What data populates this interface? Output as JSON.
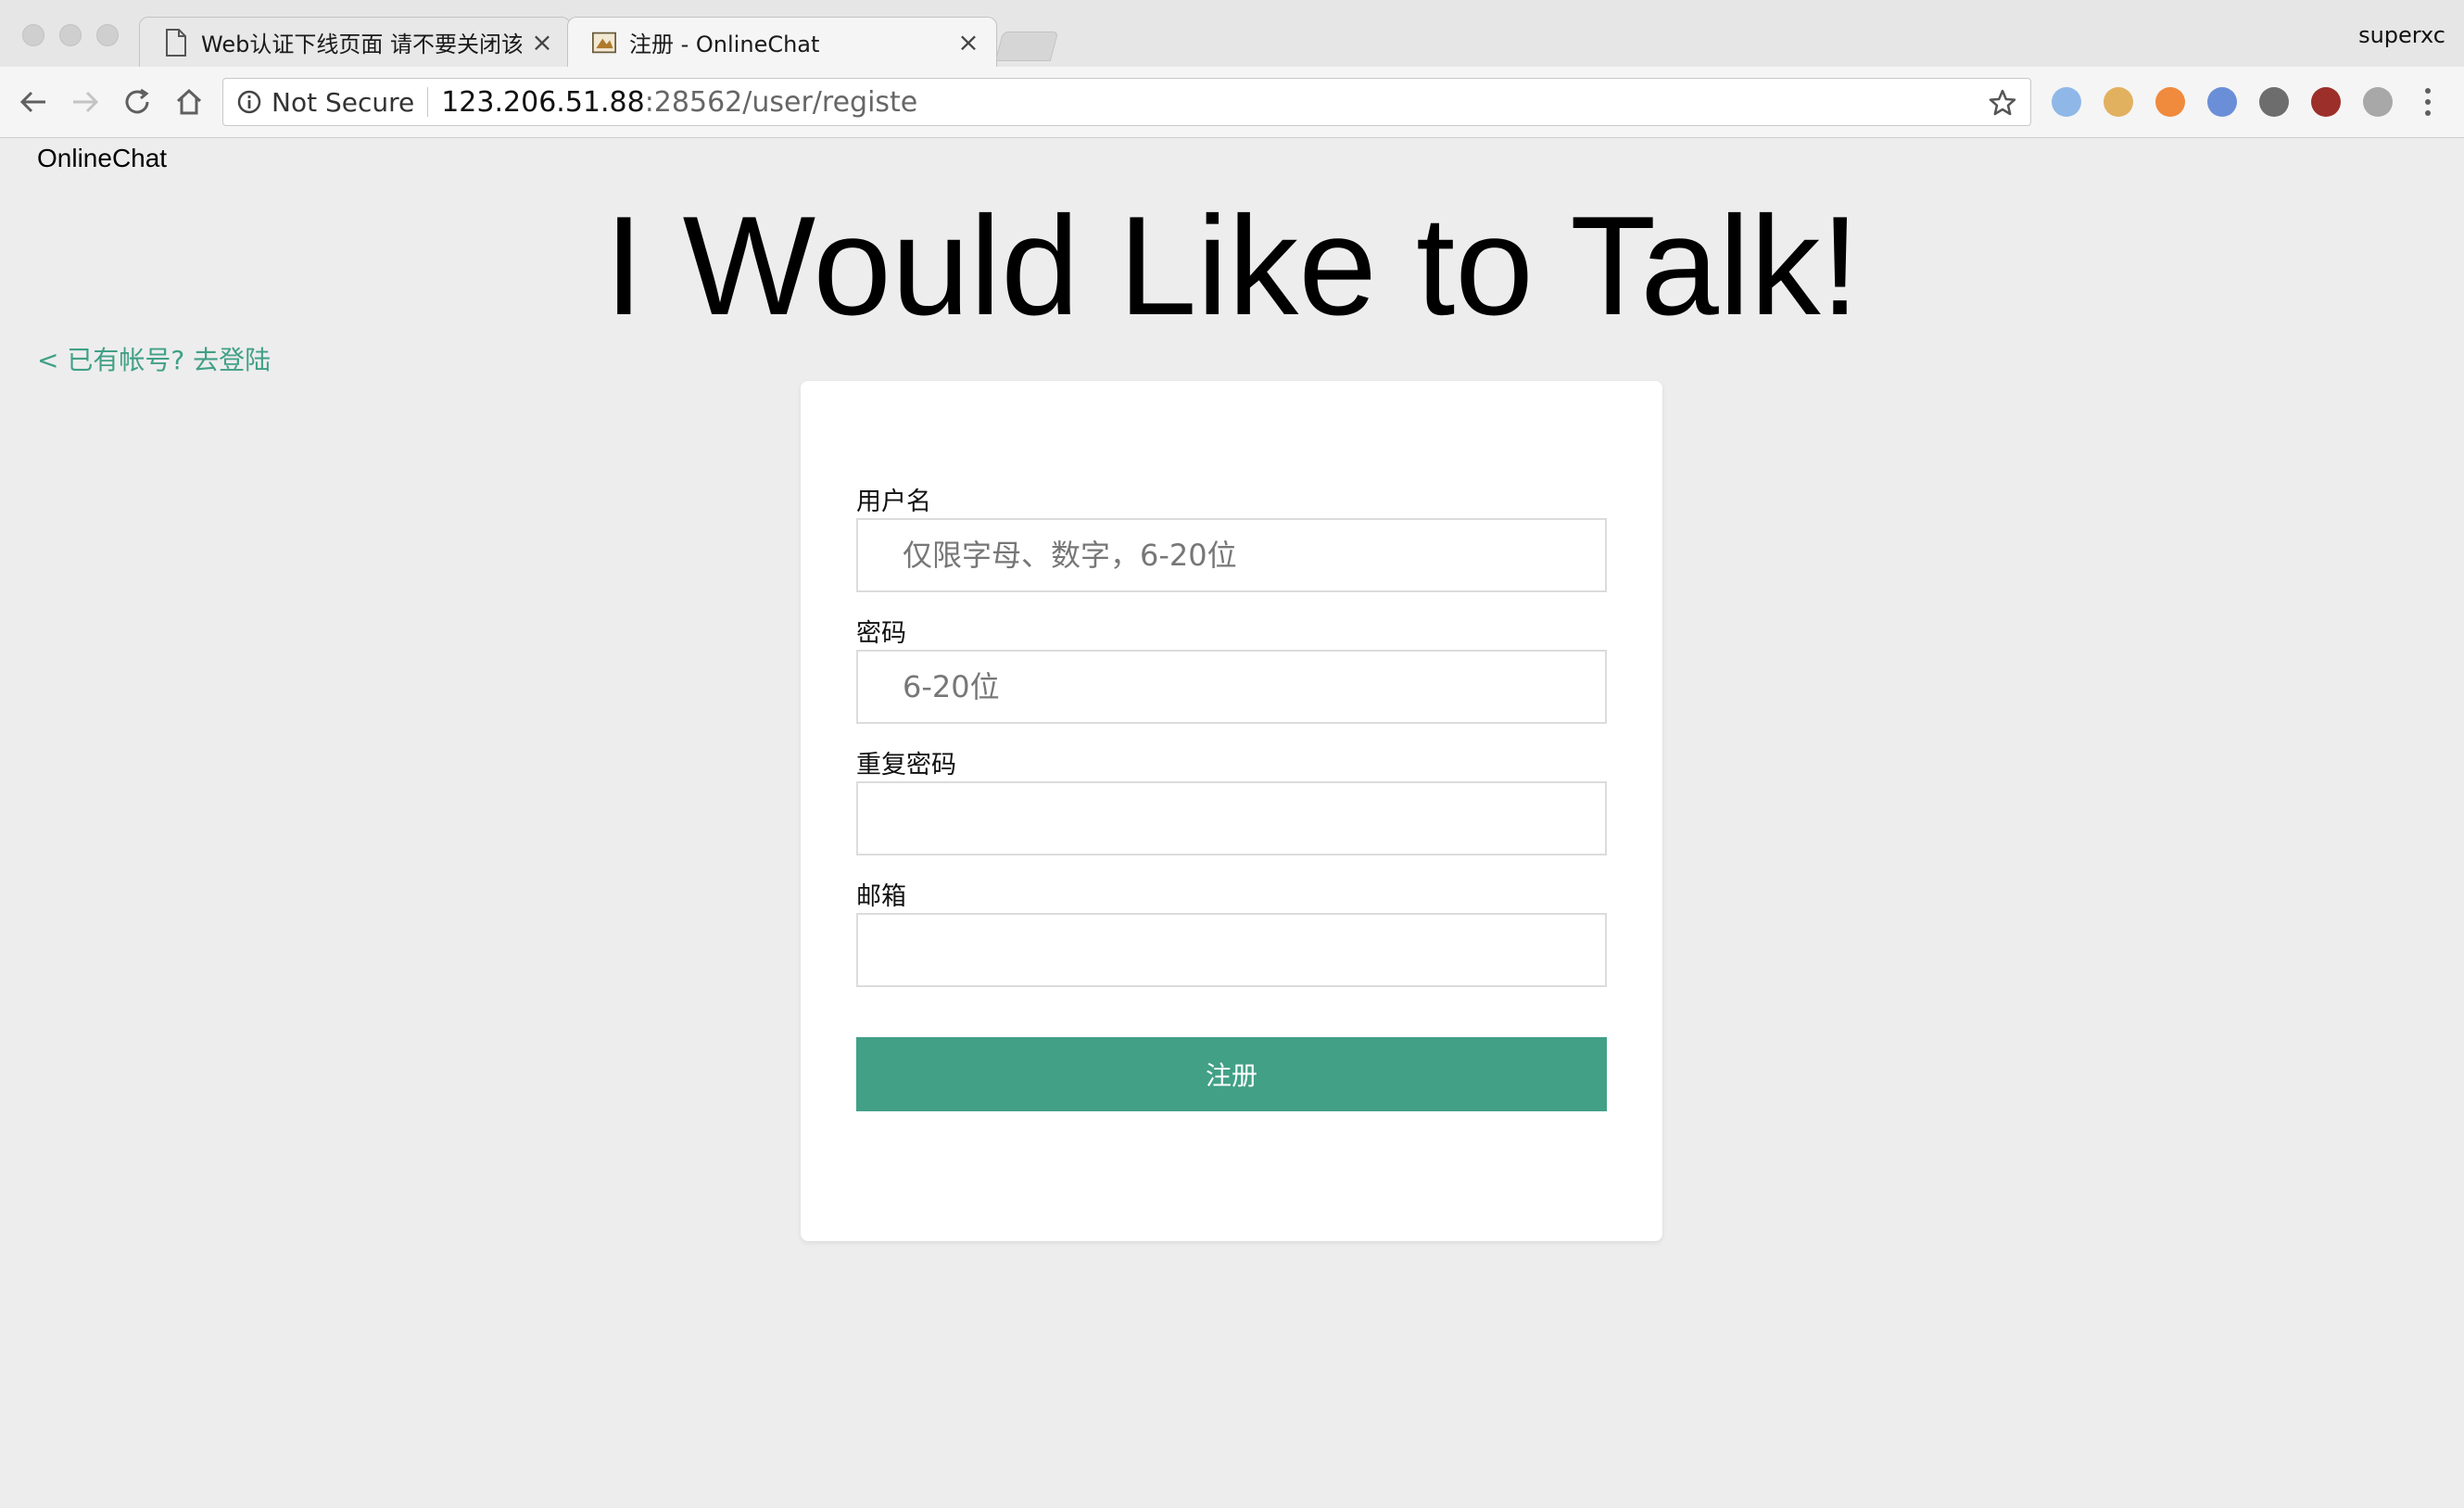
{
  "browser": {
    "tabs": [
      {
        "title": "Web认证下线页面 请不要关闭该",
        "close": "×",
        "icon": "document-icon"
      },
      {
        "title": "注册 - OnlineChat",
        "close": "×",
        "icon": "favicon-icon"
      }
    ],
    "profile": "superxc",
    "address_bar": {
      "security": "Not Secure",
      "host": "123.206.51.88",
      "rest": ":28562/user/registe"
    },
    "extensions": [
      {
        "name": "extension-blue-icon",
        "color": "#8fb8e8"
      },
      {
        "name": "cookie-extension-icon",
        "color": "#e2b15f"
      },
      {
        "name": "lifebuoy-extension-icon",
        "color": "#f08a3c"
      },
      {
        "name": "globe-extension-icon",
        "color": "#6a8fd8"
      },
      {
        "name": "cloud-extension-icon",
        "color": "#6d6d6d"
      },
      {
        "name": "ublock-extension-icon",
        "color": "#9c2f2a"
      },
      {
        "name": "puzzle-extension-icon",
        "color": "#a8a8a8"
      }
    ]
  },
  "page": {
    "brand": "OnlineChat",
    "headline": "I Would Like to Talk!",
    "back_link": "< 已有帐号?  去登陆",
    "form": {
      "username_label": "用户名",
      "username_placeholder": "仅限字母、数字，6-20位",
      "password_label": "密码",
      "password_placeholder": "6-20位",
      "repeat_label": "重复密码",
      "email_label": "邮箱",
      "submit": "注册"
    }
  },
  "colors": {
    "accent": "#41a086",
    "page_background": "#ededed",
    "card_background": "#ffffff"
  }
}
